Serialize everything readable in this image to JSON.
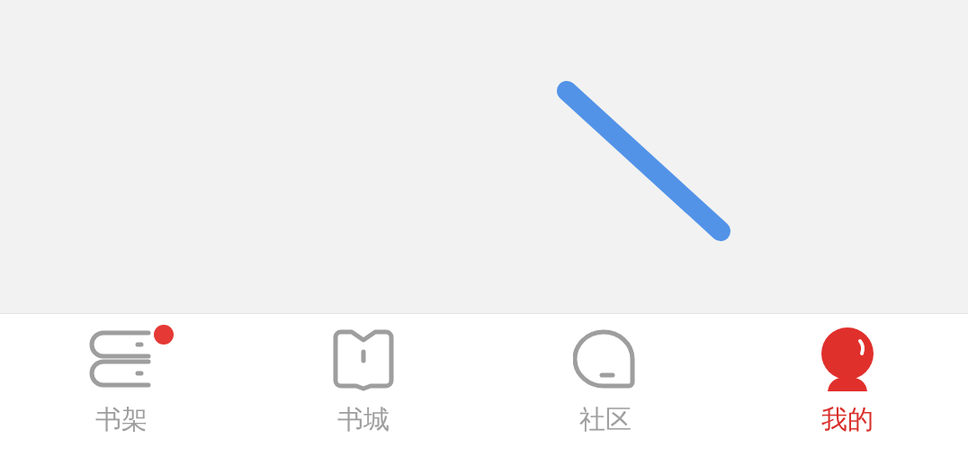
{
  "tabs": [
    {
      "label": "书架",
      "kind": "shelf",
      "selected": false,
      "badge": true
    },
    {
      "label": "书城",
      "kind": "store",
      "selected": false,
      "badge": false
    },
    {
      "label": "社区",
      "kind": "community",
      "selected": false,
      "badge": false
    },
    {
      "label": "我的",
      "kind": "mine",
      "selected": true,
      "badge": false
    }
  ]
}
